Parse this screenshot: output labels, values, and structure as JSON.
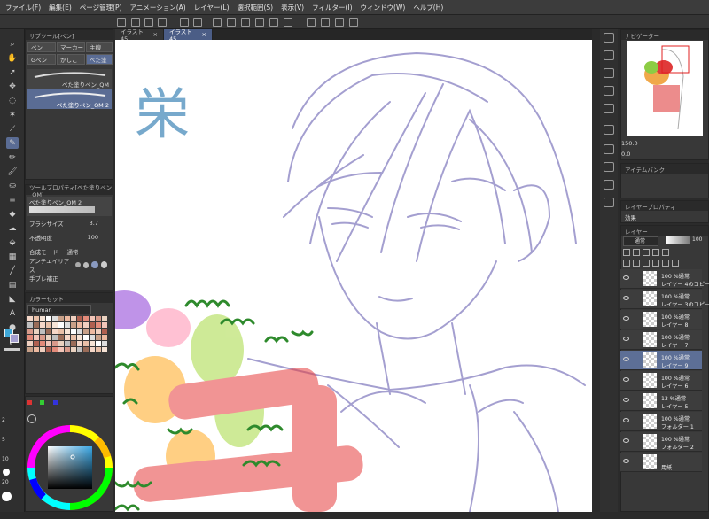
{
  "menu": [
    "ファイル(F)",
    "編集(E)",
    "ページ管理(P)",
    "アニメーション(A)",
    "レイヤー(L)",
    "選択範囲(S)",
    "表示(V)",
    "フィルター(I)",
    "ウィンドウ(W)",
    "ヘルプ(H)"
  ],
  "tabs": [
    {
      "label": "イラスト45"
    },
    {
      "label": "イラスト45"
    }
  ],
  "subtool": {
    "title": "サブツール[ペン]",
    "tabs": [
      "ペン",
      "マーカー",
      "主線",
      "Gペン",
      "かしこ",
      "べた塗"
    ],
    "brushes": [
      "べた塗りペン_QM",
      "べた塗りペン_QM 2"
    ]
  },
  "toolprop": {
    "title": "ツールプロパティ[べた塗りペン_QM]",
    "brush_name": "べた塗りペン_QM 2",
    "brush_size_label": "ブラシサイズ",
    "brush_size_value": "3.7",
    "opacity_label": "不透明度",
    "opacity_value": "100",
    "blend_label": "合成モード",
    "blend_value": "通常",
    "aa_label": "アンチエイリアス",
    "stabilize_label": "手ブレ補正"
  },
  "colorset": {
    "title": "カラーセット",
    "name": "human"
  },
  "navigator": {
    "title": "ナビゲーター",
    "zoom": "150.0",
    "angle": "0.0"
  },
  "item_bank": {
    "title": "アイテムバンク"
  },
  "layer_props": {
    "title": "レイヤープロパティ",
    "effect": "効果"
  },
  "layers_panel": {
    "tab": "レイヤー",
    "blend": "通常",
    "opacity": "100"
  },
  "layers": [
    {
      "pct": "100 %通常",
      "name": "レイヤー 4のコピー",
      "selected": false
    },
    {
      "pct": "100 %通常",
      "name": "レイヤー 3のコピー",
      "selected": false
    },
    {
      "pct": "100 %通常",
      "name": "レイヤー 8",
      "selected": false
    },
    {
      "pct": "100 %通常",
      "name": "レイヤー 7",
      "selected": false
    },
    {
      "pct": "100 %通常",
      "name": "レイヤー 9",
      "selected": true
    },
    {
      "pct": "100 %通常",
      "name": "レイヤー 6",
      "selected": false
    },
    {
      "pct": "13 %通常",
      "name": "レイヤー 5",
      "selected": false
    },
    {
      "pct": "100 %通常",
      "name": "フォルダー 1",
      "selected": false
    },
    {
      "pct": "100 %通常",
      "name": "フォルダー 2",
      "selected": false
    },
    {
      "pct": "",
      "name": "用紙",
      "selected": false
    }
  ],
  "left_numbers": [
    "2",
    "5",
    "10",
    "20"
  ],
  "canvas_glyph": "栄",
  "colors": {
    "accent": "#5a6c94",
    "sketch": "#a49fd0",
    "green": "#2e8a2c",
    "selected_layer": "#5d6f96"
  }
}
